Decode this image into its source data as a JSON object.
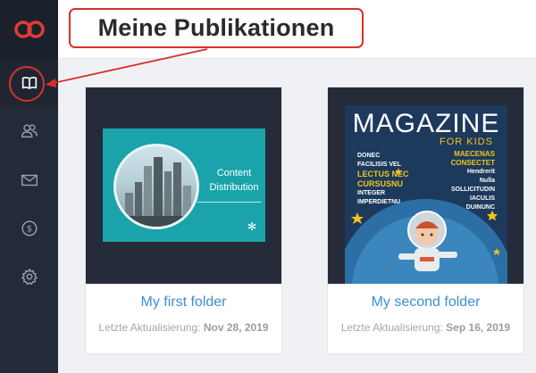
{
  "callout": {
    "label": "Meine Publikationen"
  },
  "sidebar": {
    "items": [
      {
        "name": "publications",
        "icon": "book-icon",
        "active": true
      },
      {
        "name": "contacts",
        "icon": "users-icon",
        "active": false
      },
      {
        "name": "messages",
        "icon": "mail-icon",
        "active": false
      },
      {
        "name": "billing",
        "icon": "dollar-icon",
        "active": false
      },
      {
        "name": "settings",
        "icon": "gear-icon",
        "active": false
      }
    ]
  },
  "colors": {
    "accent": "#d9302b",
    "link": "#3d8fd1",
    "sidebar": "#242b38"
  },
  "folders": [
    {
      "title": "My first folder",
      "updated_label": "Letzte Aktualisierung:",
      "updated_date": "Nov 28, 2019",
      "cover": {
        "line1": "Content",
        "line2": "Distribution"
      }
    },
    {
      "title": "My second folder",
      "updated_label": "Letzte Aktualisierung:",
      "updated_date": "Sep 16, 2019",
      "cover": {
        "title": "MAGAZINE",
        "subtitle": "FOR KIDS",
        "left": [
          "DONEC",
          "FACILISIS VEL",
          "LECTUS NEC",
          "CURSUSNU",
          "INTEGER",
          "IMPERDIETNU"
        ],
        "right": [
          "MAECENAS",
          "CONSECTET",
          "Hendrerit",
          "Nulla",
          "SOLLICITUDIN",
          "IACULIS",
          "DUINUNC"
        ]
      }
    }
  ]
}
